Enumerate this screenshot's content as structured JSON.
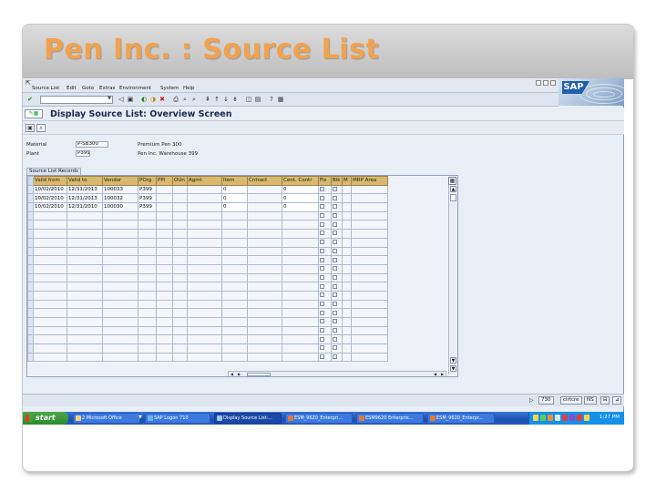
{
  "slide": {
    "title": "Pen Inc. :  Source List"
  },
  "menu": {
    "items": [
      "Source List",
      "Edit",
      "Goto",
      "Extras",
      "Environment",
      "System",
      "Help"
    ]
  },
  "screen": {
    "title": "Display Source List: Overview Screen"
  },
  "header": {
    "material_label": "Material",
    "material_value": "P-SB300",
    "material_desc": "Premium Pen 300",
    "plant_label": "Plant",
    "plant_value": "P399",
    "plant_desc": "Pen Inc. Warehouse 399"
  },
  "table": {
    "caption": "Source List Records",
    "columns": [
      "Valid from",
      "Valid to",
      "Vendor",
      "POrg",
      "PPl",
      "OUn",
      "Agmt",
      "Item",
      "Cntract",
      "Cent. Contr",
      "Fix",
      "Blk",
      "M",
      "MRP Area"
    ],
    "rows": [
      [
        "10/02/2010",
        "12/31/2013",
        "100033",
        "P399",
        "",
        "",
        "",
        "0",
        "",
        "0"
      ],
      [
        "10/02/2010",
        "12/31/2013",
        "100032",
        "P399",
        "",
        "",
        "",
        "0",
        "",
        "0"
      ],
      [
        "10/02/2010",
        "12/31/2010",
        "100030",
        "P399",
        "",
        "",
        "",
        "0",
        "",
        "0"
      ]
    ]
  },
  "status": {
    "system": "730",
    "server": "cirtcre",
    "mode": "NS"
  },
  "taskbar": {
    "start": "start",
    "tasks": [
      "2 Microsoft Office",
      "SAP Logon 710",
      "Display Source List:...",
      "ESM_9620_Enterpri...",
      "ESM9620 Enterpris...",
      "ESM_9620_Enterpr..."
    ],
    "clock": "1:27 PM"
  },
  "colors": {
    "title": "#f2a24e",
    "table_header": "#d9b96d",
    "taskbar": "#245dd0",
    "start": "#3c9a3c"
  }
}
